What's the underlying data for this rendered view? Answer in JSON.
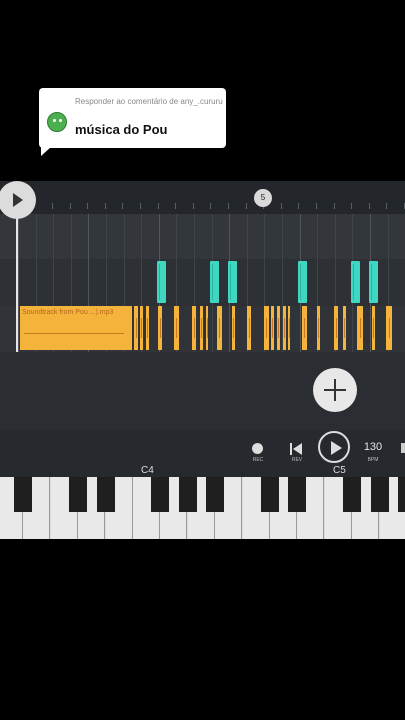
{
  "comment": {
    "reply_label": "Responder ao comentário de any_.cururu",
    "title": "música do Pou"
  },
  "timeline": {
    "marker_number": "5",
    "audio_clip_label": "Soundtrack from Pou ...).mp3"
  },
  "transport": {
    "rec_label": "REC",
    "rev_label": "REV",
    "bpm_value": "130",
    "bpm_label": "BPM"
  },
  "keyboard": {
    "c4_label": "C4",
    "c5_label": "C5"
  },
  "colors": {
    "note_color": "#3fd6c2",
    "audio_color": "#f4b43c",
    "background": "#2b2f33"
  }
}
